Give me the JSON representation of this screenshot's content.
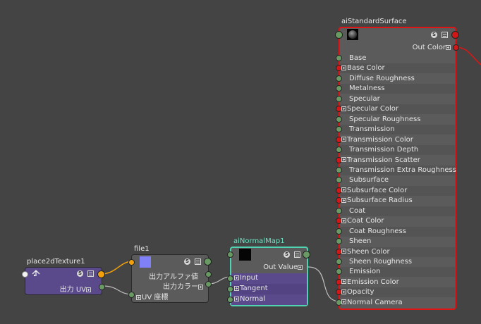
{
  "colors": {
    "background": "#444444",
    "selected_border": "#e01414",
    "wire_orange": "#f2a10c",
    "wire_normal": "#bfbfbf",
    "wire_red": "#e01414",
    "node_purple": "#5a4a8c",
    "node_teal_border": "#4fd3b0"
  },
  "place2d": {
    "title": "place2dTexture1",
    "output_label": "出力 UV"
  },
  "file": {
    "title": "file1",
    "outputs": [
      "出力アルファ値",
      "出力カラー"
    ],
    "input_label": "UV 座標"
  },
  "normalmap": {
    "title": "aiNormalMap1",
    "output_label": "Out Value",
    "inputs": [
      "Input",
      "Tangent",
      "Normal"
    ]
  },
  "standard": {
    "title": "aiStandardSurface",
    "output_label": "Out Color",
    "attributes": [
      {
        "label": "Base",
        "port": "green",
        "plus": false
      },
      {
        "label": "Base Color",
        "port": "red",
        "plus": true
      },
      {
        "label": "Diffuse Roughness",
        "port": "green",
        "plus": false
      },
      {
        "label": "Metalness",
        "port": "green",
        "plus": false
      },
      {
        "label": "Specular",
        "port": "green",
        "plus": false
      },
      {
        "label": "Specular Color",
        "port": "red",
        "plus": true
      },
      {
        "label": "Specular Roughness",
        "port": "green",
        "plus": false
      },
      {
        "label": "Transmission",
        "port": "green",
        "plus": false
      },
      {
        "label": "Transmission Color",
        "port": "red",
        "plus": true
      },
      {
        "label": "Transmission Depth",
        "port": "green",
        "plus": false
      },
      {
        "label": "Transmission Scatter",
        "port": "red",
        "plus": true
      },
      {
        "label": "Transmission Extra Roughness",
        "port": "green",
        "plus": false
      },
      {
        "label": "Subsurface",
        "port": "green",
        "plus": false
      },
      {
        "label": "Subsurface Color",
        "port": "red",
        "plus": true
      },
      {
        "label": "Subsurface Radius",
        "port": "red",
        "plus": true
      },
      {
        "label": "Coat",
        "port": "green",
        "plus": false
      },
      {
        "label": "Coat Color",
        "port": "red",
        "plus": true
      },
      {
        "label": "Coat Roughness",
        "port": "green",
        "plus": false
      },
      {
        "label": "Sheen",
        "port": "green",
        "plus": false
      },
      {
        "label": "Sheen Color",
        "port": "red",
        "plus": true
      },
      {
        "label": "Sheen Roughness",
        "port": "green",
        "plus": false
      },
      {
        "label": "Emission",
        "port": "green",
        "plus": false
      },
      {
        "label": "Emission Color",
        "port": "red",
        "plus": true
      },
      {
        "label": "Opacity",
        "port": "red",
        "plus": true
      },
      {
        "label": "Normal Camera",
        "port": "green",
        "plus": true
      }
    ]
  },
  "icons": {
    "swatch_mode": "s-icon",
    "attr_list": "list-icon",
    "place2d": "place2d-icon",
    "file_swatch": "texture-swatch-icon",
    "sphere_swatch": "sphere-swatch-icon"
  }
}
